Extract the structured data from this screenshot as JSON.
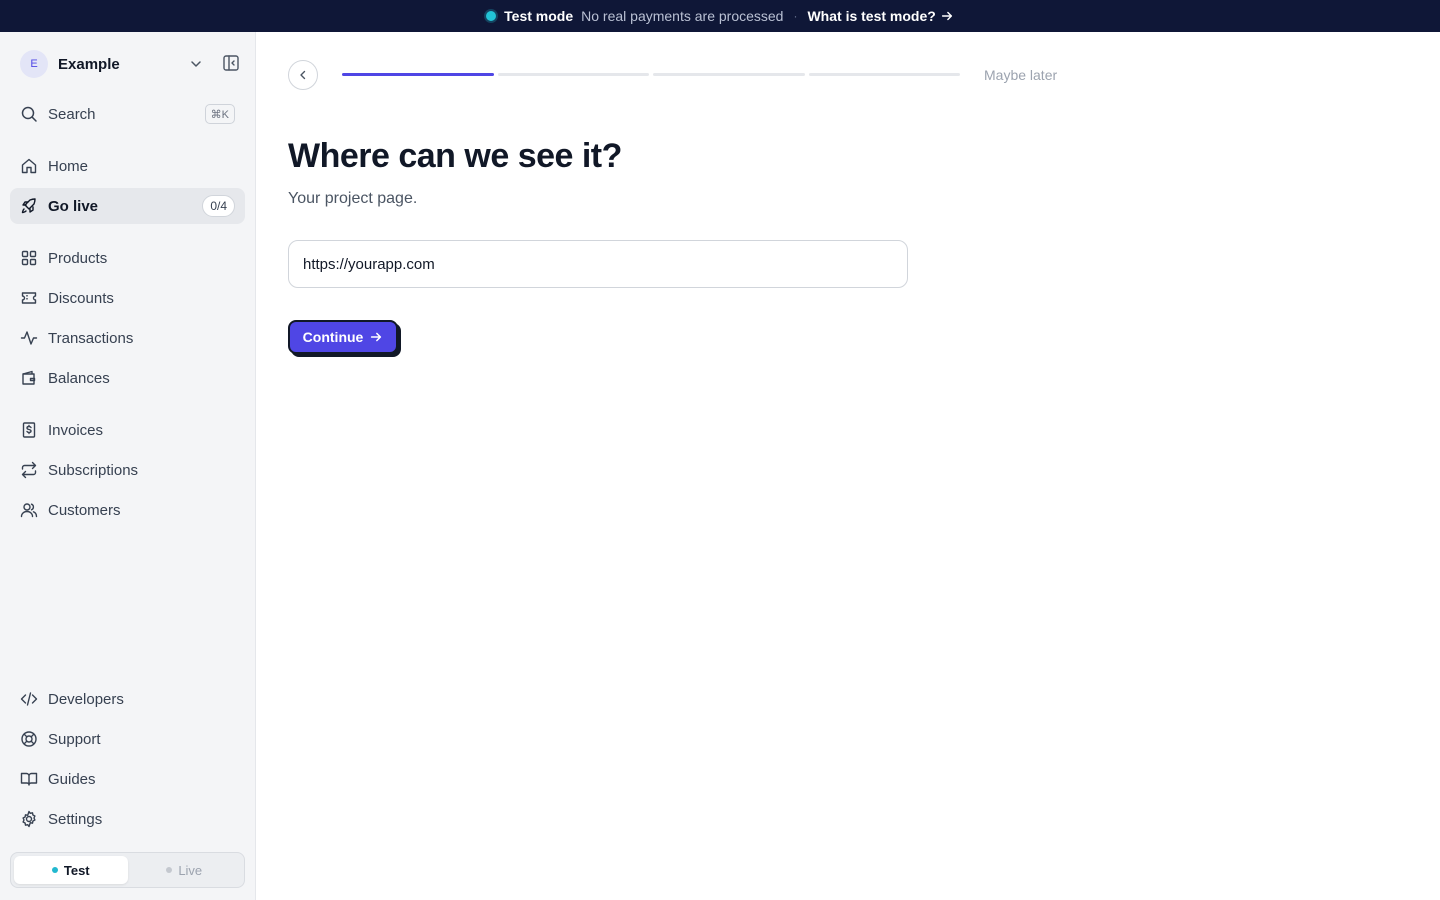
{
  "banner": {
    "mode": "Test mode",
    "description": "No real payments are processed",
    "separator": "·",
    "link": "What is test mode?"
  },
  "workspace": {
    "initial": "E",
    "name": "Example"
  },
  "sidebar": {
    "search": {
      "label": "Search",
      "shortcut": "⌘K"
    },
    "items": [
      {
        "label": "Home",
        "icon": "home-icon"
      },
      {
        "label": "Go live",
        "icon": "rocket-icon",
        "badge": "0/4",
        "active": true
      },
      {
        "label": "Products",
        "icon": "grid-icon"
      },
      {
        "label": "Discounts",
        "icon": "ticket-icon"
      },
      {
        "label": "Transactions",
        "icon": "activity-icon"
      },
      {
        "label": "Balances",
        "icon": "wallet-icon"
      },
      {
        "label": "Invoices",
        "icon": "invoice-icon"
      },
      {
        "label": "Subscriptions",
        "icon": "repeat-icon"
      },
      {
        "label": "Customers",
        "icon": "users-icon"
      },
      {
        "label": "Developers",
        "icon": "code-icon"
      },
      {
        "label": "Support",
        "icon": "lifebuoy-icon"
      },
      {
        "label": "Guides",
        "icon": "book-icon"
      },
      {
        "label": "Settings",
        "icon": "gear-icon"
      }
    ],
    "env_toggle": {
      "test": "Test",
      "live": "Live",
      "selected": "Test"
    }
  },
  "main": {
    "maybe_later": "Maybe later",
    "progress": {
      "completed_steps": 1,
      "total_steps": 4
    },
    "title": "Where can we see it?",
    "subtitle": "Your project page.",
    "url_input": {
      "value": "https://yourapp.com"
    },
    "continue_label": "Continue"
  },
  "colors": {
    "accent": "#4f46e5",
    "banner_bg": "#0f1737",
    "test_dot": "#22c3d6"
  }
}
